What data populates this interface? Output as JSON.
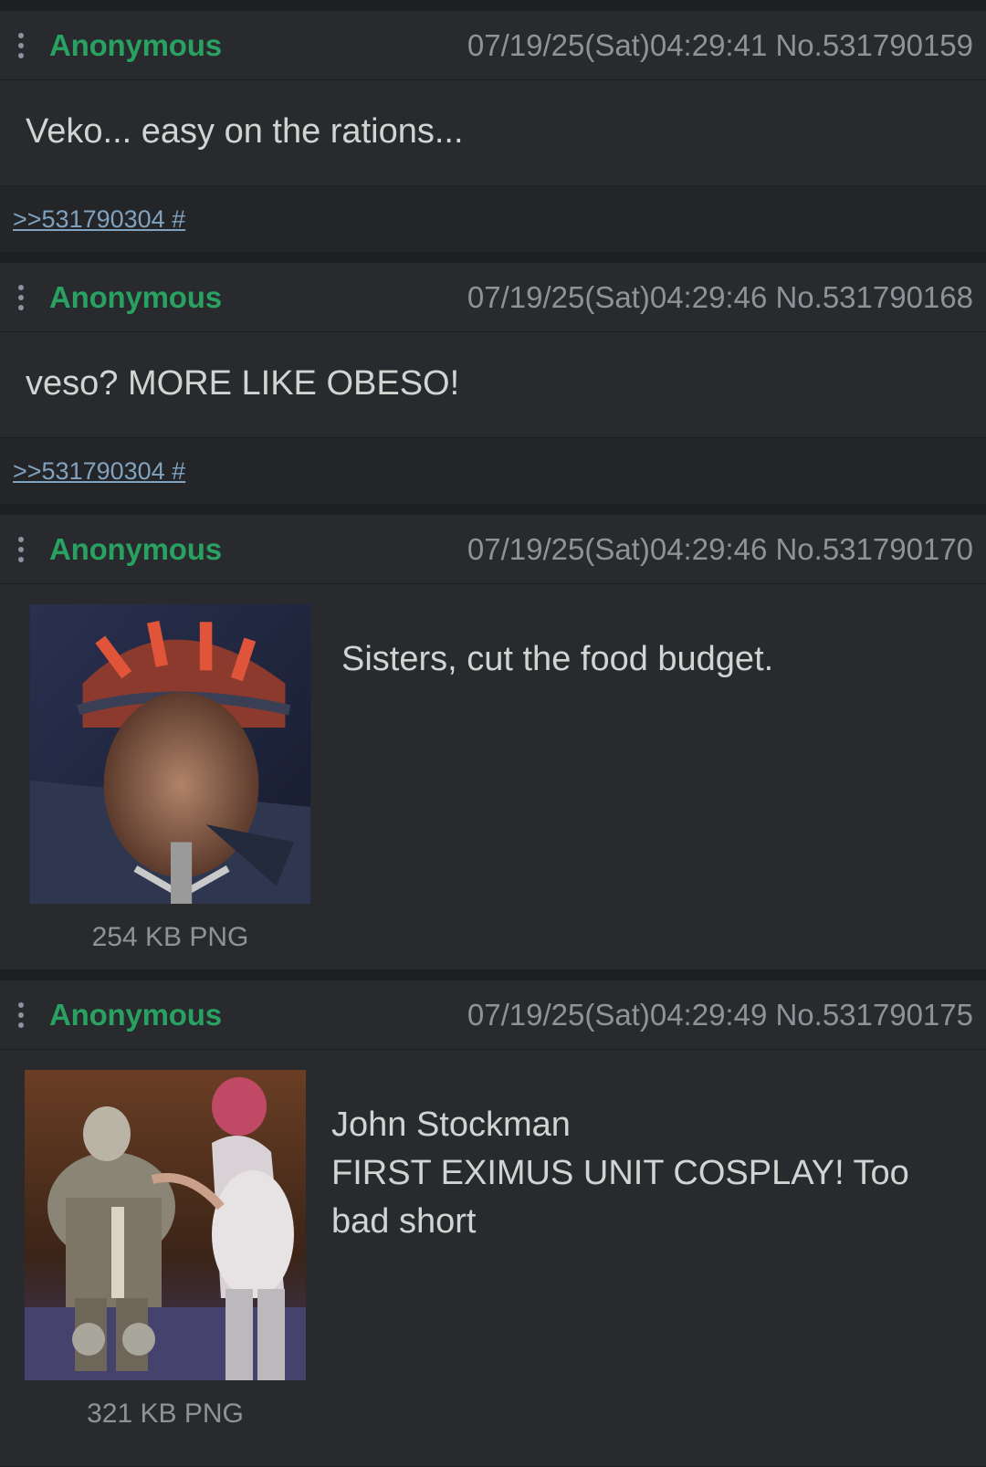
{
  "posts": [
    {
      "name": "Anonymous",
      "meta": "07/19/25(Sat)04:29:41 No.531790159",
      "body": "Veko... easy on the rations...",
      "reply_link": ">>531790304 #"
    },
    {
      "name": "Anonymous",
      "meta": "07/19/25(Sat)04:29:46 No.531790168",
      "body": "veso? MORE LIKE OBESO!",
      "reply_link": ">>531790304 #"
    },
    {
      "name": "Anonymous",
      "meta": "07/19/25(Sat)04:29:46 No.531790170",
      "body": "Sisters, cut the food budget.",
      "file_info": "254 KB PNG"
    },
    {
      "name": "Anonymous",
      "meta": "07/19/25(Sat)04:29:49 No.531790175",
      "body_line1": "John Stockman",
      "body_line2": "FIRST EXIMUS UNIT COSPLAY! Too bad short",
      "file_info": "321 KB PNG"
    }
  ],
  "colors": {
    "background": "#1d1f21",
    "post_bg": "#282a2e",
    "name": "#29a160",
    "link": "#81a2be",
    "meta": "#8f9297"
  }
}
